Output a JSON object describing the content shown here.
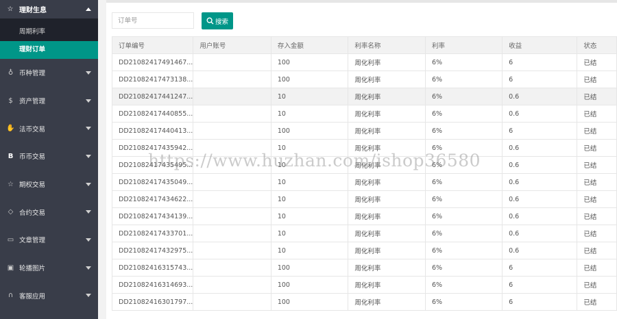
{
  "sidebar": {
    "group": {
      "icon": "star-outline-icon",
      "label": "理财生息",
      "sub_items": [
        "周期利率",
        "理财订单"
      ],
      "active_index": 1
    },
    "items": [
      {
        "icon": "coin-icon",
        "label": "币种管理"
      },
      {
        "icon": "dollar-circle-icon",
        "label": "资产管理"
      },
      {
        "icon": "hand-icon",
        "label": "法币交易"
      },
      {
        "icon": "bitcoin-icon",
        "label": "币币交易"
      },
      {
        "icon": "star-outline-icon",
        "label": "期权交易"
      },
      {
        "icon": "diamond-icon",
        "label": "合约交易"
      },
      {
        "icon": "book-icon",
        "label": "文章管理"
      },
      {
        "icon": "image-icon",
        "label": "轮播图片"
      },
      {
        "icon": "headset-icon",
        "label": "客服应用"
      }
    ]
  },
  "search": {
    "placeholder": "订单号",
    "button_label": "搜索"
  },
  "table": {
    "columns": [
      "订单编号",
      "用户账号",
      "存入金额",
      "利率名称",
      "利率",
      "收益",
      "状态"
    ],
    "rows": [
      [
        "DD21082417491467...",
        "",
        "100",
        "周化利率",
        "6%",
        "6",
        "已结"
      ],
      [
        "DD21082417473138...",
        "",
        "100",
        "周化利率",
        "6%",
        "6",
        "已结"
      ],
      [
        "DD21082417441247...",
        "",
        "10",
        "周化利率",
        "6%",
        "0.6",
        "已结"
      ],
      [
        "DD21082417440855...",
        "",
        "10",
        "周化利率",
        "6%",
        "0.6",
        "已结"
      ],
      [
        "DD21082417440413...",
        "",
        "100",
        "周化利率",
        "6%",
        "6",
        "已结"
      ],
      [
        "DD21082417435942...",
        "",
        "10",
        "周化利率",
        "6%",
        "0.6",
        "已结"
      ],
      [
        "DD21082417435495...",
        "",
        "10",
        "周化利率",
        "6%",
        "0.6",
        "已结"
      ],
      [
        "DD21082417435049...",
        "",
        "10",
        "周化利率",
        "6%",
        "0.6",
        "已结"
      ],
      [
        "DD21082417434622...",
        "",
        "10",
        "周化利率",
        "6%",
        "0.6",
        "已结"
      ],
      [
        "DD21082417434139...",
        "",
        "10",
        "周化利率",
        "6%",
        "0.6",
        "已结"
      ],
      [
        "DD21082417433701...",
        "",
        "10",
        "周化利率",
        "6%",
        "0.6",
        "已结"
      ],
      [
        "DD21082417432975...",
        "",
        "10",
        "周化利率",
        "6%",
        "0.6",
        "已结"
      ],
      [
        "DD21082416315743...",
        "",
        "100",
        "周化利率",
        "6%",
        "6",
        "已结"
      ],
      [
        "DD21082416314693...",
        "",
        "100",
        "周化利率",
        "6%",
        "6",
        "已结"
      ],
      [
        "DD21082416301797...",
        "",
        "100",
        "周化利率",
        "6%",
        "6",
        "已结"
      ]
    ],
    "highlighted_row": 2
  },
  "watermark": "https://www.huzhan.com/ishop36580",
  "colors": {
    "sidebar_bg": "#393d49",
    "submenu_bg": "#1f222b",
    "accent": "#009688"
  }
}
